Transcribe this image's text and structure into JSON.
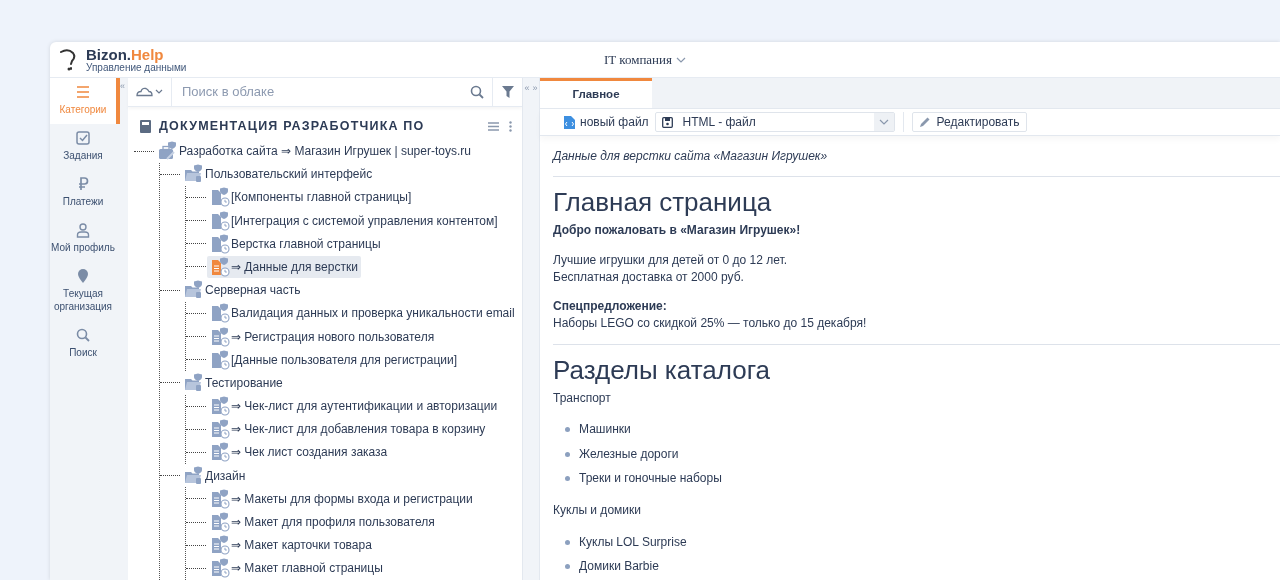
{
  "header": {
    "brand_main": "Bizon.",
    "brand_accent": "Help",
    "brand_sub": "Управление данными",
    "organization": "IT компания"
  },
  "splitters": {
    "left": "«",
    "middle_left": "«",
    "middle_right": "»"
  },
  "sidebar": {
    "items": [
      {
        "kind": "menu",
        "label": "Категории",
        "selected": true
      },
      {
        "kind": "check",
        "label": "Задания",
        "selected": false
      },
      {
        "kind": "ruble",
        "label": "Платежи",
        "selected": false
      },
      {
        "kind": "person",
        "label": "Мой профиль",
        "selected": false
      },
      {
        "kind": "pin",
        "label": "Текущая организация",
        "selected": false
      },
      {
        "kind": "search",
        "label": "Поиск",
        "selected": false
      }
    ]
  },
  "tree_panel": {
    "search": {
      "placeholder": "Поиск в облаке"
    },
    "title": "ДОКУМЕНТАЦИЯ РАЗРАБОТЧИКА ПО",
    "tree": [
      {
        "kind": "project",
        "label": "Разработка сайта ⇒ Магазин Игрушек | super-toys.ru",
        "selected": false,
        "children": [
          {
            "kind": "folder",
            "label": "Пользовательский интерфейс",
            "selected": false,
            "children": [
              {
                "kind": "doc",
                "label": "[Компоненты главной страницы]",
                "selected": false
              },
              {
                "kind": "doc",
                "label": "[Интеграция с системой управления контентом]",
                "selected": false
              },
              {
                "kind": "doc",
                "label": "Верстка главной страницы",
                "selected": false
              },
              {
                "kind": "text",
                "label": "⇒ Данные для верстки",
                "selected": true
              }
            ]
          },
          {
            "kind": "folder",
            "label": "Серверная часть",
            "selected": false,
            "children": [
              {
                "kind": "doc",
                "label": "Валидация данных и проверка уникальности email",
                "selected": false
              },
              {
                "kind": "text",
                "label": "⇒ Регистрация нового пользователя",
                "selected": false
              },
              {
                "kind": "doc",
                "label": "[Данные пользователя для регистрации]",
                "selected": false
              }
            ]
          },
          {
            "kind": "folder",
            "label": "Тестирование",
            "selected": false,
            "children": [
              {
                "kind": "text",
                "label": "⇒ Чек-лист для аутентификации и авторизации",
                "selected": false
              },
              {
                "kind": "text",
                "label": "⇒ Чек-лист для добавления товара в корзину",
                "selected": false
              },
              {
                "kind": "text",
                "label": "⇒ Чек лист создания заказа",
                "selected": false
              }
            ]
          },
          {
            "kind": "folder",
            "label": "Дизайн",
            "selected": false,
            "children": [
              {
                "kind": "text",
                "label": "⇒ Макеты для формы входа и регистрации",
                "selected": false
              },
              {
                "kind": "text",
                "label": "⇒ Макет для профиля пользователя",
                "selected": false
              },
              {
                "kind": "text",
                "label": "⇒ Макет карточки товара",
                "selected": false
              },
              {
                "kind": "text",
                "label": "⇒ Макет главной страницы",
                "selected": false
              }
            ]
          }
        ]
      }
    ]
  },
  "document": {
    "tabs": [
      {
        "label": "Главное",
        "selected": true
      }
    ],
    "toolbar": {
      "new_file": "новый файл",
      "format": "HTML - файл",
      "edit": "Редактировать"
    },
    "blocks": [
      {
        "kind": "caption",
        "text": "Данные для верстки сайта «Магазин Игрушек»"
      },
      {
        "kind": "rule"
      },
      {
        "kind": "heading",
        "text": "Главная страница"
      },
      {
        "kind": "strong",
        "text": "Добро пожаловать в «Магазин Игрушек»!"
      },
      {
        "kind": "lines",
        "lines": [
          "Лучшие игрушки для детей от 0 до 12 лет.",
          "Бесплатная доставка от 2000 руб."
        ]
      },
      {
        "kind": "lines",
        "lines": [
          "**Спецпредложение:**",
          "Наборы LEGO со скидкой 25% — только до 15 декабря!"
        ]
      },
      {
        "kind": "rule"
      },
      {
        "kind": "heading",
        "text": "Разделы каталога"
      },
      {
        "kind": "paragraph",
        "text": "Транспорт"
      },
      {
        "kind": "list",
        "items": [
          "Машинки",
          "Железные дороги",
          "Треки и гоночные наборы"
        ]
      },
      {
        "kind": "paragraph",
        "text": "Куклы и домики"
      },
      {
        "kind": "list",
        "items": [
          "Куклы LOL Surprise",
          "Домики Barbie"
        ]
      }
    ]
  }
}
